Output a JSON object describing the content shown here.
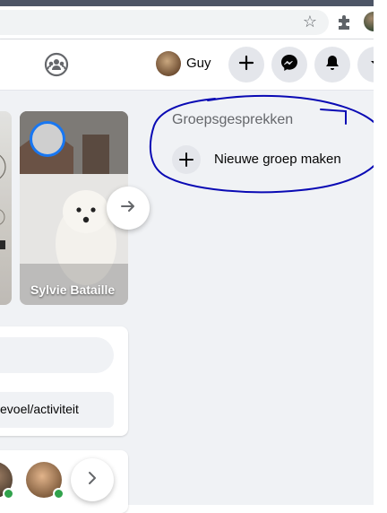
{
  "header": {
    "user_name": "Guy"
  },
  "stories": {
    "visible_name": "Sylvie Bataille"
  },
  "composer": {
    "feeling_label": "evoel/activiteit"
  },
  "sidebar_right": {
    "section_title": "Groepsgesprekken",
    "new_group_label": "Nieuwe groep maken"
  },
  "colors": {
    "accent": "#1877f2",
    "annotation_ink": "#0a0ab4",
    "background": "#f0f2f5",
    "online": "#31a24c"
  },
  "icons": {
    "bookmark": "star-icon",
    "extensions": "puzzle-icon",
    "groups": "groups-icon",
    "create": "plus-icon",
    "messenger": "messenger-icon",
    "notifications": "bell-icon",
    "menu": "chevron-down-icon",
    "next": "arrow-right-icon"
  }
}
